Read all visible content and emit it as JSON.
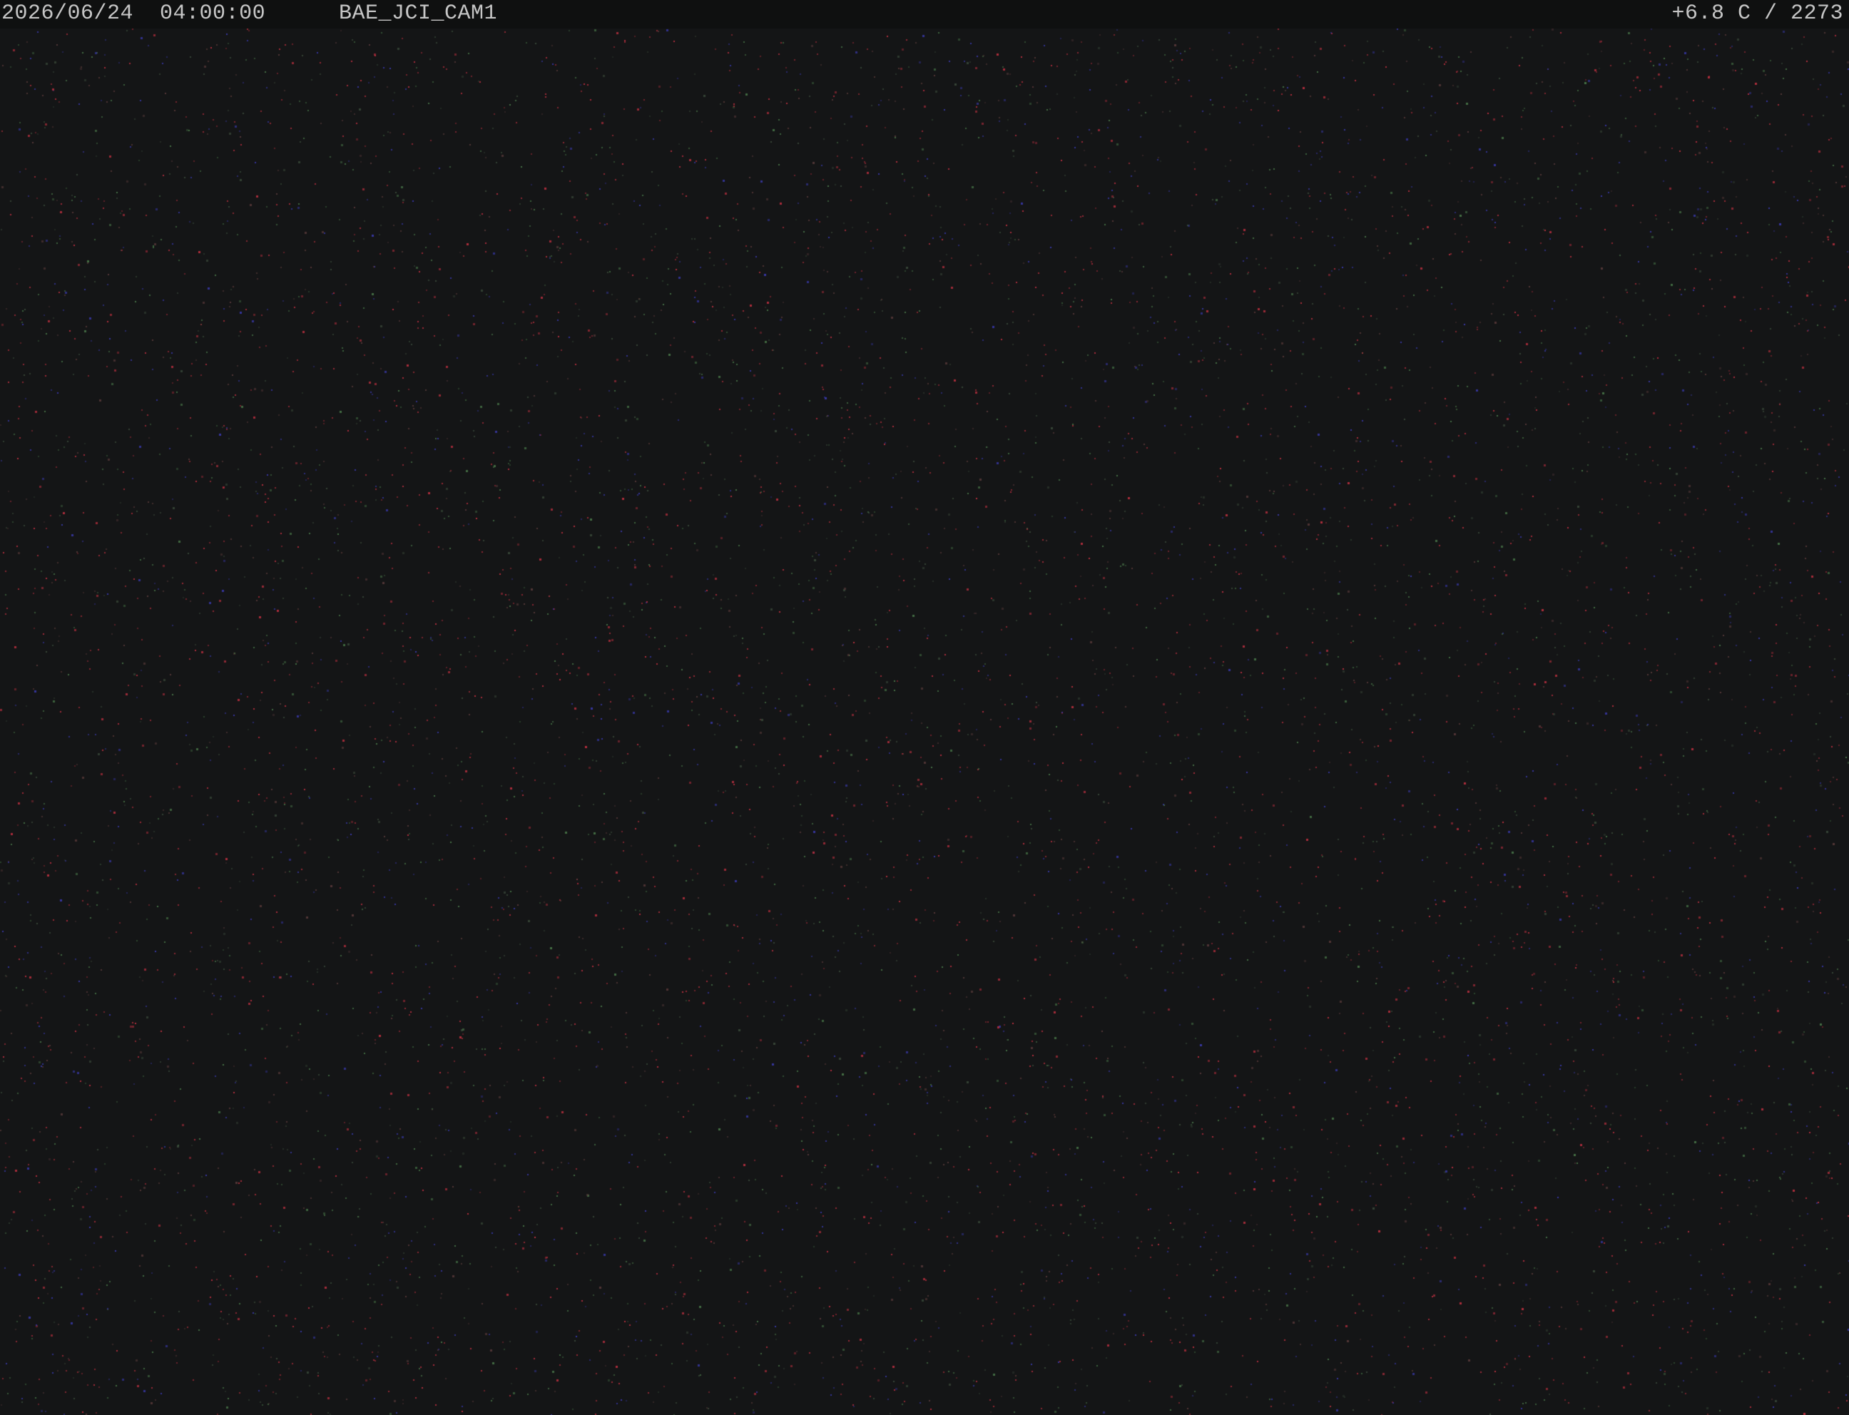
{
  "overlay": {
    "date": "2026/06/24",
    "time": "04:00:00",
    "camera_name": "BAE_JCI_CAM1",
    "reading": "+6.8 C / 2273"
  },
  "colors": {
    "background": "#141516",
    "overlay_bar": "#0f1010",
    "overlay_text": "#c6c6c6",
    "noise_red": "#c03040",
    "noise_green": "#4a7a4a",
    "noise_blue": "#3a3ab0"
  }
}
